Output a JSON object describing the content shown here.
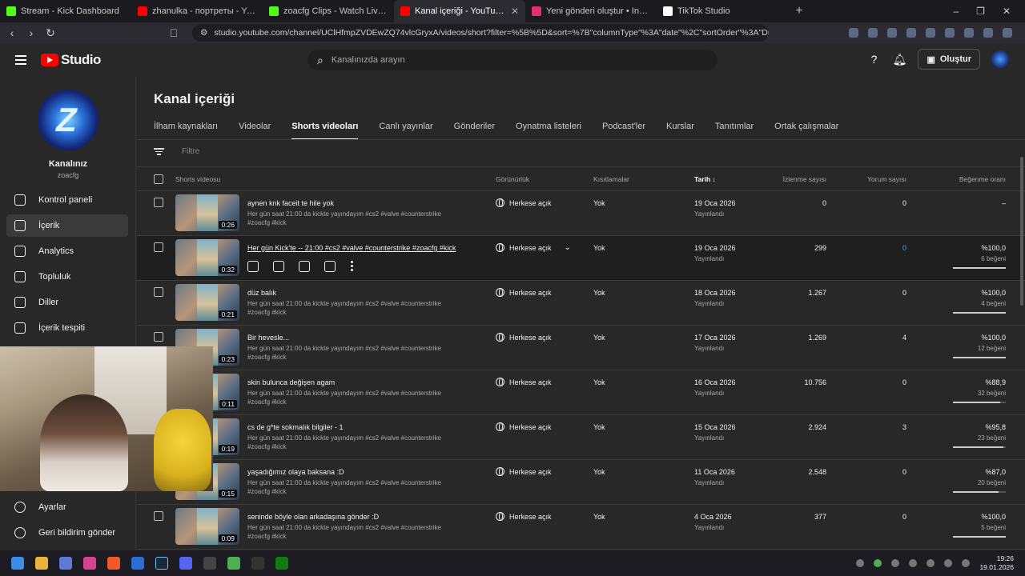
{
  "browser": {
    "tabs": [
      {
        "label": "Stream - Kick Dashboard",
        "color": "#53fc18"
      },
      {
        "label": "zhanulka - портреты - YouTube",
        "color": "#ff0000"
      },
      {
        "label": "zoacfg Clips - Watch Live on Kick",
        "color": "#53fc18"
      },
      {
        "label": "Kanal içeriği - YouTube Studio",
        "color": "#ff0000"
      },
      {
        "label": "Yeni gönderi oluştur • Instagram",
        "color": "#e1306c"
      },
      {
        "label": "TikTok Studio",
        "color": "#ffffff"
      }
    ],
    "url": "studio.youtube.com/channel/UClHfmpZVDEwZQ74vlcGryxA/videos/short?filter=%5B%5D&sort=%7B\"columnType\"%3A\"date\"%2C\"sortOrder\"%3A\"DE..."
  },
  "header": {
    "logo_text": "Studio",
    "search_placeholder": "Kanalınızda arayın",
    "create_label": "Oluştur"
  },
  "sidebar": {
    "channel_name": "Kanalınız",
    "channel_handle": "zoacfg",
    "items": [
      {
        "label": "Kontrol paneli",
        "icon": "dashboard-icon"
      },
      {
        "label": "İçerik",
        "icon": "content-icon"
      },
      {
        "label": "Analytics",
        "icon": "analytics-icon"
      },
      {
        "label": "Topluluk",
        "icon": "community-icon"
      },
      {
        "label": "Diller",
        "icon": "subtitles-icon"
      },
      {
        "label": "İçerik tespiti",
        "icon": "copyright-icon"
      }
    ],
    "bottom": [
      {
        "label": "Ayarlar",
        "icon": "gear-icon"
      },
      {
        "label": "Geri bildirim gönder",
        "icon": "feedback-icon"
      }
    ]
  },
  "main": {
    "title": "Kanal içeriği",
    "tabs": [
      "İlham kaynakları",
      "Videolar",
      "Shorts videoları",
      "Canlı yayınlar",
      "Gönderiler",
      "Oynatma listeleri",
      "Podcast'ler",
      "Kurslar",
      "Tanıtımlar",
      "Ortak çalışmalar"
    ],
    "active_tab": "Shorts videoları",
    "filter_placeholder": "Filtre",
    "columns": {
      "video": "Shorts videosu",
      "visibility": "Görünürlük",
      "restrictions": "Kısıtlamalar",
      "date": "Tarih",
      "views": "İzlenme sayısı",
      "comments": "Yorum sayısı",
      "likes": "Beğenme oranı"
    },
    "rows": [
      {
        "title": "aynen knk faceit te hile yok",
        "desc": "Her gün saat 21:00 da kickte yayındayım #cs2 #valve #counterstrike #zoacfg #kick",
        "duration": "0:26",
        "visibility": "Herkese açık",
        "restrictions": "Yok",
        "date": "19 Oca 2026",
        "status": "Yayınlandı",
        "views": "0",
        "comments": "0",
        "likes": "–",
        "likes_sub": "",
        "like_fraction": 0
      },
      {
        "title": "Her gün Kick'te -- 21:00 #cs2 #valve #counterstrike #zoacfg #kick",
        "desc": "",
        "duration": "0:32",
        "visibility": "Herkese açık",
        "restrictions": "Yok",
        "date": "19 Oca 2026",
        "status": "Yayınlandı",
        "views": "299",
        "comments": "0",
        "likes": "%100,0",
        "likes_sub": "6 beğeni",
        "like_fraction": 1.0
      },
      {
        "title": "düz balık",
        "desc": "Her gün saat 21:00 da kickte yayındayım #cs2 #valve #counterstrike #zoacfg #kick",
        "duration": "0:21",
        "visibility": "Herkese açık",
        "restrictions": "Yok",
        "date": "18 Oca 2026",
        "status": "Yayınlandı",
        "views": "1.267",
        "comments": "0",
        "likes": "%100,0",
        "likes_sub": "4 beğeni",
        "like_fraction": 1.0
      },
      {
        "title": "Bir hevesle...",
        "desc": "Her gün saat 21:00 da kickte yayındayım #cs2 #valve #counterstrike #zoacfg #kick",
        "duration": "0:23",
        "visibility": "Herkese açık",
        "restrictions": "Yok",
        "date": "17 Oca 2026",
        "status": "Yayınlandı",
        "views": "1.269",
        "comments": "4",
        "likes": "%100,0",
        "likes_sub": "12 beğeni",
        "like_fraction": 1.0
      },
      {
        "title": "skin bulunca değişen agam",
        "desc": "Her gün saat 21:00 da kickte yayındayım #cs2 #valve #counterstrike #zoacfg #kick",
        "duration": "0:11",
        "visibility": "Herkese açık",
        "restrictions": "Yok",
        "date": "16 Oca 2026",
        "status": "Yayınlandı",
        "views": "10.756",
        "comments": "0",
        "likes": "%88,9",
        "likes_sub": "32 beğeni",
        "like_fraction": 0.889
      },
      {
        "title": "cs de g*te sokmalık bilgiler - 1",
        "desc": "Her gün saat 21:00 da kickte yayındayım #cs2 #valve #counterstrike #zoacfg #kick",
        "duration": "0:19",
        "visibility": "Herkese açık",
        "restrictions": "Yok",
        "date": "15 Oca 2026",
        "status": "Yayınlandı",
        "views": "2.924",
        "comments": "3",
        "likes": "%95,8",
        "likes_sub": "23 beğeni",
        "like_fraction": 0.958
      },
      {
        "title": "yaşadığımız olaya baksana :D",
        "desc": "Her gün saat 21:00 da kickte yayındayım #cs2 #valve #counterstrike #zoacfg #kick",
        "duration": "0:15",
        "visibility": "Herkese açık",
        "restrictions": "Yok",
        "date": "11 Oca 2026",
        "status": "Yayınlandı",
        "views": "2.548",
        "comments": "0",
        "likes": "%87,0",
        "likes_sub": "20 beğeni",
        "like_fraction": 0.87
      },
      {
        "title": "seninde böyle olan arkadaşına gönder :D",
        "desc": "Her gün saat 21:00 da kickte yayındayım #cs2 #valve #counterstrike #zoacfg #kick",
        "duration": "0:09",
        "visibility": "Herkese açık",
        "restrictions": "Yok",
        "date": "4 Oca 2026",
        "status": "Yayınlandı",
        "views": "377",
        "comments": "0",
        "likes": "%100,0",
        "likes_sub": "5 beğeni",
        "like_fraction": 1.0
      }
    ]
  },
  "taskbar": {
    "time": "19:26",
    "date": "19.01.2026"
  }
}
